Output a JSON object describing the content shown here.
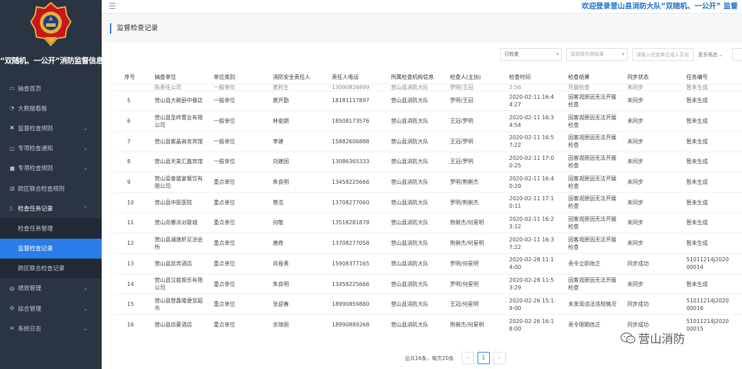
{
  "app": {
    "system_title": "“双随机、一公开”消防监督信息系统",
    "welcome": "欢迎登录营山县消防大队“双随机、一公开” 监督"
  },
  "sidebar": {
    "items": [
      {
        "label": "抽查首页",
        "icon": "monitor-icon",
        "chev": ""
      },
      {
        "label": "大数据看板",
        "icon": "dashboard-icon",
        "chev": ""
      },
      {
        "label": "监督检查规则",
        "icon": "tools-icon",
        "chev": "⌄"
      },
      {
        "label": "专项检查通知",
        "icon": "notice-icon",
        "chev": "⌄"
      },
      {
        "label": "专项检查规则",
        "icon": "file-icon",
        "chev": "⌄"
      },
      {
        "label": "跨区联合检查规则",
        "icon": "chart-icon",
        "chev": ""
      },
      {
        "label": "检查任务记录",
        "icon": "book-icon",
        "chev": "⌃"
      },
      {
        "label": "检查任务管理",
        "icon": "",
        "chev": ""
      },
      {
        "label": "监督检查记录",
        "icon": "",
        "chev": ""
      },
      {
        "label": "跨区联合检查记录",
        "icon": "",
        "chev": ""
      },
      {
        "label": "绩效管理",
        "icon": "gauge-icon",
        "chev": "⌄"
      },
      {
        "label": "综合管理",
        "icon": "gear-icon",
        "chev": "⌄"
      },
      {
        "label": "系统日志",
        "icon": "layers-icon",
        "chev": "⌄"
      }
    ]
  },
  "page": {
    "title": "监督检查记录"
  },
  "filters": {
    "status": "已检查",
    "result_placeholder": "请选择检查结果",
    "person_placeholder": "请输入检查单位或人员名",
    "more": "更多筛选 ⌄"
  },
  "table": {
    "headers": [
      "序号",
      "抽查单位",
      "单位类别",
      "消防安全责任人",
      "责任人电话",
      "所属检查机构信息",
      "检查人(主协)",
      "检查时间",
      "检查结果",
      "同步状态",
      "任务编号"
    ],
    "partial_row": [
      "",
      "陈责任公司",
      "一般单位",
      "黄利生",
      "13090826899",
      "营山县消防大队",
      "罗明/王冠",
      "2:56",
      "开展检查",
      "未同步",
      "暂未生成"
    ],
    "rows": [
      [
        "5",
        "营山县大碗厨中餐店",
        "一般单位",
        "黄开勤",
        "18181117897",
        "营山县消防大队",
        "罗明/王冠",
        "2020-02-11 16:4 4:27",
        "因客观原因无法开展检查",
        "未同步",
        "暂未生成"
      ],
      [
        "6",
        "营山县圣梓置业有限公司",
        "一般单位",
        "林俊朗",
        "18508173576",
        "营山县消防大队",
        "王冠/罗明",
        "2020-02-11 16:3 4:54",
        "因客观原因无法开展检查",
        "未同步",
        "暂未生成"
      ],
      [
        "7",
        "营山县紫晶商务宾馆",
        "一般单位",
        "李建",
        "15882606888",
        "营山县消防大队",
        "王冠/罗明",
        "2020-02-11 16:5 7:22",
        "因客观原因无法开展检查",
        "未同步",
        "暂未生成"
      ],
      [
        "8",
        "营山县天美汇鑫宾馆",
        "一般单位",
        "刘建国",
        "13086365333",
        "营山县消防大队",
        "王冠/罗明",
        "2020-02-11 17:0 0:25",
        "因客观原因无法开展检查",
        "未同步",
        "暂未生成"
      ],
      [
        "9",
        "营山梁泰盛宴餐饮有限公司",
        "重点单位",
        "朱良明",
        "13458225666",
        "营山县消防大队",
        "罗明/荆俐杰",
        "2020-02-11 16:4 0:29",
        "因客观原因无法开展检查",
        "未同步",
        "暂未生成"
      ],
      [
        "10",
        "营山县中医医院",
        "重点单位",
        "曾浩",
        "13708277060",
        "营山县消防大队",
        "罗明/荆俐杰",
        "2020-02-11 17:1 0:11",
        "因客观原因无法开展检查",
        "未同步",
        "暂未生成"
      ],
      [
        "11",
        "营山尚睿派对歌城",
        "重点单位",
        "何敬",
        "13518281878",
        "营山县消防大队",
        "荆俐杰/何星明",
        "2020-02-11 16:2 3:12",
        "因客观原因无法开展检查",
        "未同步",
        "暂未生成"
      ],
      [
        "12",
        "营山县澜逸轩足浴会所",
        "重点单位",
        "唐燕",
        "13708277058",
        "营山县消防大队",
        "荆俐杰/何星明",
        "2020-02-11 16:3 7:22",
        "因客观原因无法开展检查",
        "未同步",
        "暂未生成"
      ],
      [
        "13",
        "营山县凯宾酒店",
        "重点单位",
        "肖振勇",
        "15908377165",
        "营山县消防大队",
        "罗明/何星明",
        "2020-02-28 11:1 4:00",
        "责令立即改正",
        "同步成功",
        "51011214J2020 00014"
      ],
      [
        "14",
        "营山县汉庭娱乐有限公司",
        "重点单位",
        "朱良明",
        "13458225666",
        "营山县消防大队",
        "罗明/何星明",
        "2020-02-28 11:5 3:29",
        "因客观原因无法开展检查",
        "未同步",
        "暂未生成"
      ],
      [
        "15",
        "营山县营鑫隆便宜超市",
        "重点单位",
        "张迎春",
        "18990859880",
        "营山县消防大队",
        "王冠/何星明",
        "2020-02-26 15:1 9:00",
        "未发现违法违规情况",
        "同步成功",
        "51011214J2020 00016"
      ],
      [
        "16",
        "营山县尚豪酒店",
        "重点单位",
        "余琦丽",
        "18990889268",
        "营山县消防大队",
        "荆俐杰/何星明",
        "2020-02-26 16:1 8:00",
        "责令限期改正",
        "同步成功",
        "51011214J2020 00015"
      ]
    ]
  },
  "pagination": {
    "summary": "总共16条，每页20条",
    "prev": "‹",
    "current": "1",
    "next": "›"
  },
  "watermark": {
    "text": "营山消防"
  },
  "colors": {
    "sidebar": "#2b3443",
    "accent": "#2b7de9",
    "welcome": "#1f6fc5"
  }
}
